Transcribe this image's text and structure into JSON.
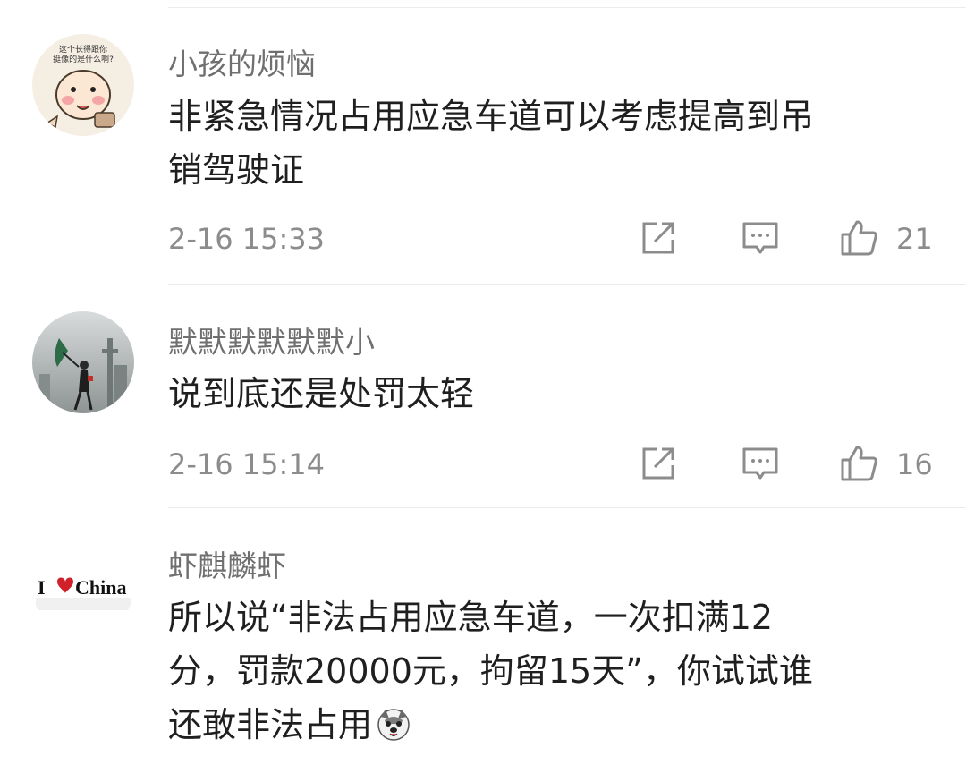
{
  "comments": [
    {
      "username": "小孩的烦恼",
      "text_lines": [
        "非紧急情况占用应急车道可以考虑提高到吊",
        "销驾驶证"
      ],
      "timestamp": "2-16 15:33",
      "likes": "21",
      "avatar_caption": "这个长得跟你 挺像的是什么啊?"
    },
    {
      "username": "默默默默默默小",
      "text_lines": [
        "说到底还是处罚太轻"
      ],
      "timestamp": "2-16 15:14",
      "likes": "16"
    },
    {
      "username": "虾麒麟虾",
      "text_lines": [
        "所以说“非法占用应急车道，一次扣满12",
        "分，罚款20000元，拘留15天”，你试试谁",
        "还敢非法占用"
      ],
      "avatar_text": {
        "prefix": "I",
        "suffix": "China"
      }
    }
  ],
  "icons": {
    "share": "share-icon",
    "reply": "comment-icon",
    "like": "thumbs-up-icon",
    "inline_emoji": "dog-face-emoji-icon"
  },
  "colors": {
    "text": "#1f1f1f",
    "username": "#6f6f6f",
    "meta": "#8c8c8c",
    "divider": "#ececec",
    "heart": "#d0212b"
  }
}
